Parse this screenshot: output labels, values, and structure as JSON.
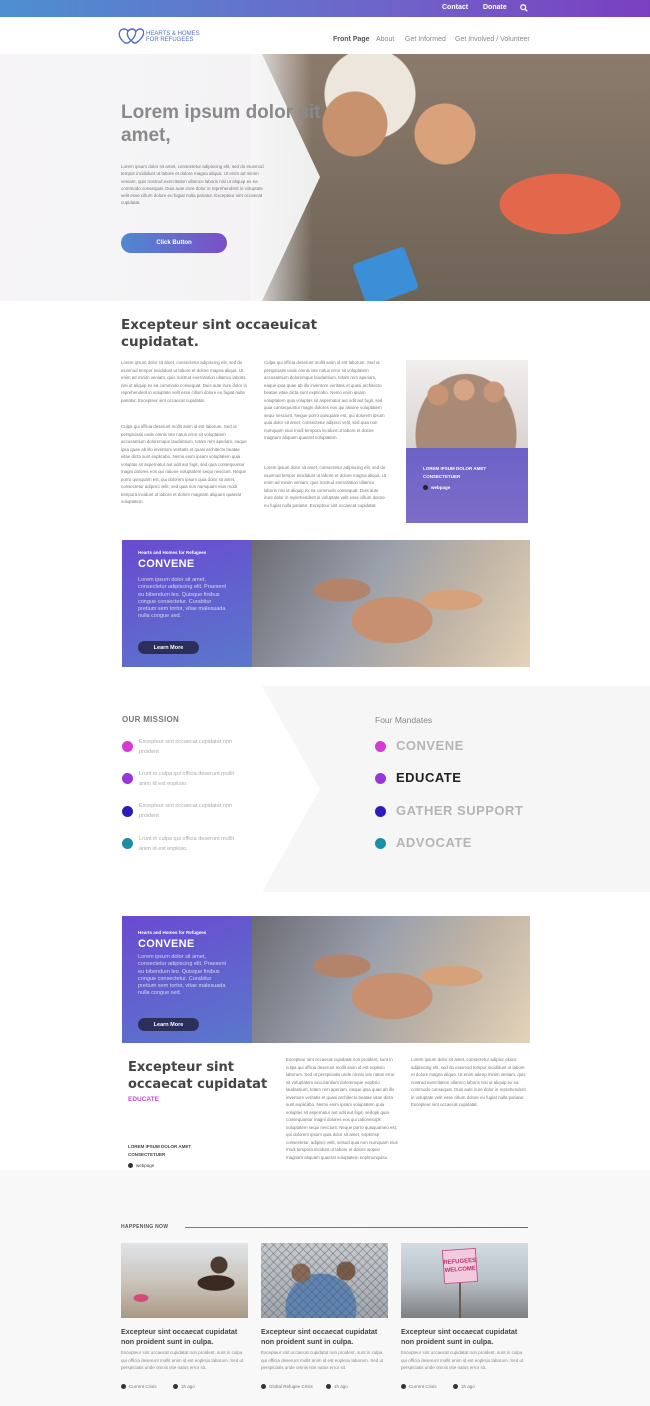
{
  "topbar": {
    "contact": "Contact",
    "donate": "Donate",
    "search_icon": "search-icon"
  },
  "logo": {
    "line1": "Hearts & Homes",
    "line2": "for Refugees"
  },
  "nav": {
    "items": [
      "Front Page",
      "About",
      "Get Informed",
      "Get Involved / Volunteer"
    ]
  },
  "hero": {
    "title": "Lorem ipsum dolor sit amet,",
    "text": "Lorem ipsum dolor sit amet, consectetur adipiscing elit, sed do eiusmod tempor incididunt ut labore et dolore magna aliqua. Ut enim ad minim veniam, quis nostrud exercitation ullamco laboris nisi ut aliquip ex ea commodo consequat. Duis aute irure dolor in reprehenderit in voluptate velit esse cillum dolore eu fugiat nulla pariatur. Excepteur sint occaecat cupidatat.",
    "button": "Click Button"
  },
  "intro": {
    "title": "Excepteur sint occaeuicat cupidatat.",
    "col1_p1": "Lorem ipsum dolor sit amet, consectetur adipiscing elit, sed do eiusmod tempor incididunt ut labore et dolore magna aliqua. Ut enim ad minim veniam, quis nostrud exercitation ullamco laboris nisi ut aliquip ex ea commodo consequat. Duis aute irure dolor in reprehenderit in voluptate velit esse cillum dolore eu fugiat nulla pariatur. Excepteur sint occaecat cupidatat.",
    "col1_p2": "Culpa qui officia deserunt mollit anim id est laborum. Sed ut perspiciatis unde omnis iste natus error sit voluptatem accusantium doloremque laudantium, totam rem aperiam, eaque ipsa quae ab illo inventore veritatis et quasi architecto beatae vitae dicta sunt explicabo. Nemo enim ipsam voluptatem quia voluptas sit aspernatur aut odit aut fugit, sed quia consequuntur magni dolores eos qui ratione voluptatem sequi nesciunt. Neque porro quisquam est, qui dolorem ipsum quia dolor sit amet, consectetur adipisci velit, sed quia non numquam eius modi tempora incidunt ut labore et dolore magnam aliquam quaerat voluptatem.",
    "col2_p1": "Culpa qui officia deserunt mollit anim id est laborum. Sed ut perspiciatis unde omnis iste natus error sit voluptatem accusantium doloremque laudantium, totam rem aperiam, eaque ipsa quae ab illo inventore veritatis et quasi architecto beatae vitae dicta sunt explicabo. Nemo enim ipsam voluptatem quia voluptas sit aspernatur aut odit aut fugit, sed quia consequuntur magni dolores eos qui ratione voluptatem sequi nesciunt. Neque porro quisquam est, qui dolorem ipsum quia dolor sit amet, consectetur adipisci velit, sed quia non numquam eius modi tempora incidunt ut labore et dolore magnam aliquam quaerat voluptatem.",
    "col2_p2": "Lorem ipsum dolor sit amet, consectetur adipiscing elit, sed do eiusmod tempor incididunt ut labore et dolore magna aliqua. Ut enim ad minim veniam, quis nostrud exercitation ullamco laboris nisi ut aliquip ex ea commodo consequat. Duis aute irure dolor in reprehenderit in voluptate velit esse cillum dolore eu fugiat nulla pariatur. Excepteur sint occaecat cupidatat.",
    "card_title": "LOREM IPSUM DOLOR AMET CONSECTETUER",
    "card_link": "webpage"
  },
  "convene1": {
    "kicker": "Hearts and Homes for Refugees",
    "title": "CONVENE",
    "text": "Lorem ipsum dolor sit amet, consectetur adipiscing elit. Praesent eu bibendum leo. Quisque finibus congue consectetur. Curabitur pretium sem tortor, vitae malesuada nulla congue sed.",
    "button": "Learn More"
  },
  "mission": {
    "heading": "OUR MISSION",
    "items": [
      "Excepteur sint occaecat cupidatat non proident",
      "Lrunt in culpa qui officia deserunt mollit anim id est eopksio.",
      "Excepteur sint occaecat cupidatat non proident",
      "Lrunt in culpa qui officia deserunt mollit anim id est eopksio."
    ],
    "dot_colors": [
      "#d63ad6",
      "#9a35d8",
      "#2d1db8",
      "#1b8fa6"
    ]
  },
  "mandates": {
    "heading": "Four Mandates",
    "items": [
      "CONVENE",
      "EDUCATE",
      "GATHER SUPPORT",
      "ADVOCATE"
    ],
    "dot_colors": [
      "#d63ad6",
      "#9a35d8",
      "#2d1db8",
      "#1b8fa6"
    ]
  },
  "convene2": {
    "kicker": "Hearts and Homes for Refugees",
    "title": "CONVENE",
    "text": "Lorem ipsum dolor sit amet, consectetur adipiscing elit. Praesent eu bibendum leo. Quisque finibus congue consectetur. Curabitur pretium sem tortor, vitae malesuada nulla congue sed.",
    "button": "Learn More"
  },
  "educate": {
    "title": "Excepteur sint occaecat cupidatat",
    "tag": "EDUCATE",
    "meta_title": "LOREM IPSUM DOLOR AMET CONSECTETUER",
    "meta_link": "webpage",
    "col1": "Excepteur sint occaecat cupidatat non proident, sunt in culpa qui officia deserunt mollit anim id est eopksio laborum. Sed ut perspiciatis unde omnis iste natus error sit voluptatem accusantium doloremque eopksio laudantium, totam rem aperiam, eaque ipsa quae ab illo inventore veritatis et quasi architecto beatae vitae dicta sunt explicabo. Nemo enim ipsam voluptatem quia voluptas sit aspernatur aut odit aut fugit, sedopk quia consequuntur magni dolores eos qui rationesopk voluptatem sequi nesciunt. Neque porro quisquameo est, qui dolorem ipsum quia dolor sit amet, eopkmsp consectetur, adipisci velit, seisud quia non numquam eius modi tempora incidunt ut labore et dolore wopeir magnam aliquam quaerat voluptatem eoplmunquisu",
    "col2": "Lorem ipsum dolor sit amet, consectetur adipisc ekiosi adipisicing elit, sed do eiusmod tempor incididunt ut labore et dolore magna aliqua. Ut enim adeop minim veniam, quis nostrud exercitation ullamco laboris nisi ut aliquip ex ea commodo consequat. Duis aute irure dolor in reprehenderit in voluptate velit esse cillum dolore eu fugiat nulla pariatur. Excepteur sint occaecat cupidatat."
  },
  "happening": {
    "heading": "HAPPENING NOW",
    "cards": [
      {
        "title": "Excepteur sint occaecat cupidatat non proident sunt in culpa.",
        "text": "Excepteur sint occaecat cupidatat non proident, sunt in culpa qui officia deserunt mollit anim id est eopksio laborum. Sed ut perspiciatis unde omnis iste natus error sit.",
        "category": "Current Crisis",
        "time": "1h ago"
      },
      {
        "title": "Excepteur sint occaecat cupidatat non proident sunt in culpa.",
        "text": "Excepteur sint occaecat cupidatat non proident, sunt in culpa qui officia deserunt mollit anim id est eopksio laborum. Sed ut perspiciatis unde omnis iste natus error sit.",
        "category": "Global Refugee Crisis",
        "time": "1h ago"
      },
      {
        "title": "Excepteur sint occaecat cupidatat non proident sunt in culpa.",
        "text": "Excepteur sint occaecat cupidatat non proident, sunt in culpa qui officia deserunt mollit anim id est eopksio laborum. Sed ut perspiciatis unde omnis iste natus error sit.",
        "category": "Current Crisis",
        "time": "1h ago"
      }
    ],
    "sign_text": "REFUGEES WELCOME"
  }
}
